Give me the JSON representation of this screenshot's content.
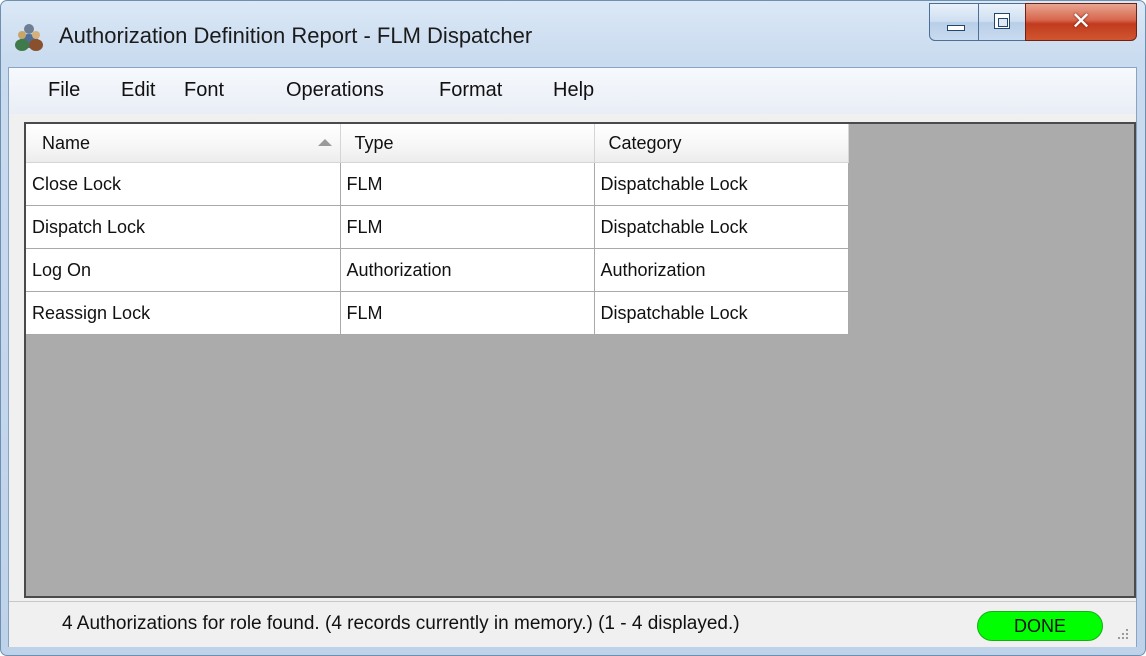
{
  "window": {
    "title": "Authorization Definition Report - FLM Dispatcher"
  },
  "icons": {
    "app": "users-group-icon",
    "minimize": "minimize-icon",
    "maximize": "restore-icon",
    "close": "close-icon",
    "sort": "sort-ascending-icon",
    "grip": "resize-grip-icon"
  },
  "menu": [
    {
      "label": "File"
    },
    {
      "label": "Edit"
    },
    {
      "label": "Font"
    },
    {
      "label": "Operations"
    },
    {
      "label": "Format"
    },
    {
      "label": "Help"
    }
  ],
  "table": {
    "columns": [
      {
        "label": "Name"
      },
      {
        "label": "Type"
      },
      {
        "label": "Category"
      }
    ],
    "rows": [
      {
        "name": "Close Lock",
        "type": "FLM",
        "category": "Dispatchable Lock"
      },
      {
        "name": "Dispatch Lock",
        "type": "FLM",
        "category": "Dispatchable Lock"
      },
      {
        "name": "Log On",
        "type": "Authorization",
        "category": "Authorization"
      },
      {
        "name": "Reassign Lock",
        "type": "FLM",
        "category": "Dispatchable Lock"
      }
    ]
  },
  "status": {
    "message": "4 Authorizations for role found.  (4 records currently in memory.)  (1 - 4 displayed.)",
    "state": "DONE",
    "state_color": "#00ff00"
  },
  "colors": {
    "grid_background": "#ababab",
    "close_button": "#c13b1e"
  }
}
